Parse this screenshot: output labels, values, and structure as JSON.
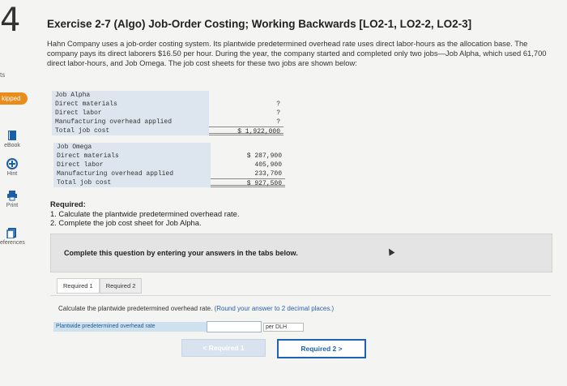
{
  "question_number": "4",
  "sidebar": {
    "top_fragment": "ts",
    "skipped_badge": "kipped",
    "items": [
      {
        "label": "eBook",
        "icon": "book-icon"
      },
      {
        "label": "Hint",
        "icon": "hint-icon"
      },
      {
        "label": "Print",
        "icon": "print-icon"
      },
      {
        "label": "eferences",
        "icon": "references-icon"
      }
    ]
  },
  "title": "Exercise 2-7 (Algo) Job-Order Costing; Working Backwards [LO2-1, LO2-2, LO2-3]",
  "intro": "Hahn Company uses a job-order costing system. Its plantwide predetermined overhead rate uses direct labor-hours as the allocation base. The company pays its direct laborers $16.50 per hour. During the year, the company started and completed only two jobs—Job Alpha, which used 61,700 direct labor-hours, and Job Omega. The job cost sheets for these two jobs are shown below:",
  "job_alpha": {
    "header": "Job Alpha",
    "rows": [
      {
        "label": "Direct materials",
        "value": "?"
      },
      {
        "label": "Direct labor",
        "value": "?"
      },
      {
        "label": "Manufacturing overhead applied",
        "value": "?"
      },
      {
        "label": "Total job cost",
        "value": "$ 1,922,000"
      }
    ]
  },
  "job_omega": {
    "header": "Job Omega",
    "rows": [
      {
        "label": "Direct materials",
        "value": "$ 287,900"
      },
      {
        "label": "Direct labor",
        "value": "405,900"
      },
      {
        "label": "Manufacturing overhead applied",
        "value": "233,700"
      },
      {
        "label": "Total job cost",
        "value": "$ 927,500"
      }
    ]
  },
  "required": {
    "heading": "Required:",
    "items": [
      "1. Calculate the plantwide predetermined overhead rate.",
      "2. Complete the job cost sheet for Job Alpha."
    ]
  },
  "panel_text": "Complete this question by entering your answers in the tabs below.",
  "tabs": [
    "Required 1",
    "Required 2"
  ],
  "instruction": "Calculate the plantwide predetermined overhead rate.",
  "instruction_hint": "(Round your answer to 2 decimal places.)",
  "answer": {
    "label": "Plantwide predetermined overhead rate",
    "value": "",
    "unit": "per DLH"
  },
  "nav": {
    "prev": "< Required 1",
    "next": "Required 2 >"
  }
}
